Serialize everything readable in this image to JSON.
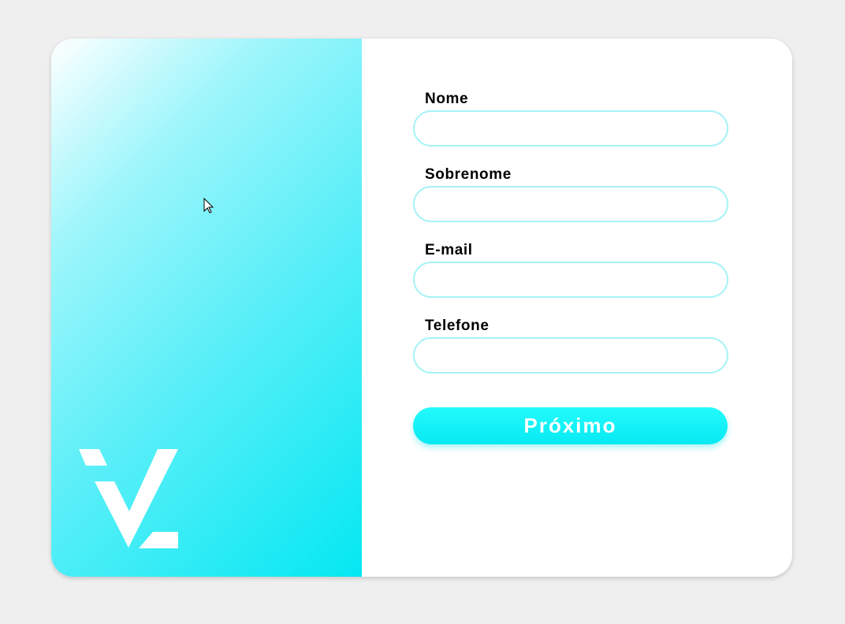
{
  "form": {
    "fields": [
      {
        "label": "Nome",
        "value": "",
        "placeholder": ""
      },
      {
        "label": "Sobrenome",
        "value": "",
        "placeholder": ""
      },
      {
        "label": "E-mail",
        "value": "",
        "placeholder": ""
      },
      {
        "label": "Telefone",
        "value": "",
        "placeholder": ""
      }
    ],
    "submit_label": "Próximo"
  },
  "icons": {
    "logo": "vl-logo-icon",
    "cursor": "mouse-pointer-icon"
  },
  "colors": {
    "accent": "#04e8f2",
    "input_border": "#a6f3f7",
    "background": "#efefef"
  }
}
